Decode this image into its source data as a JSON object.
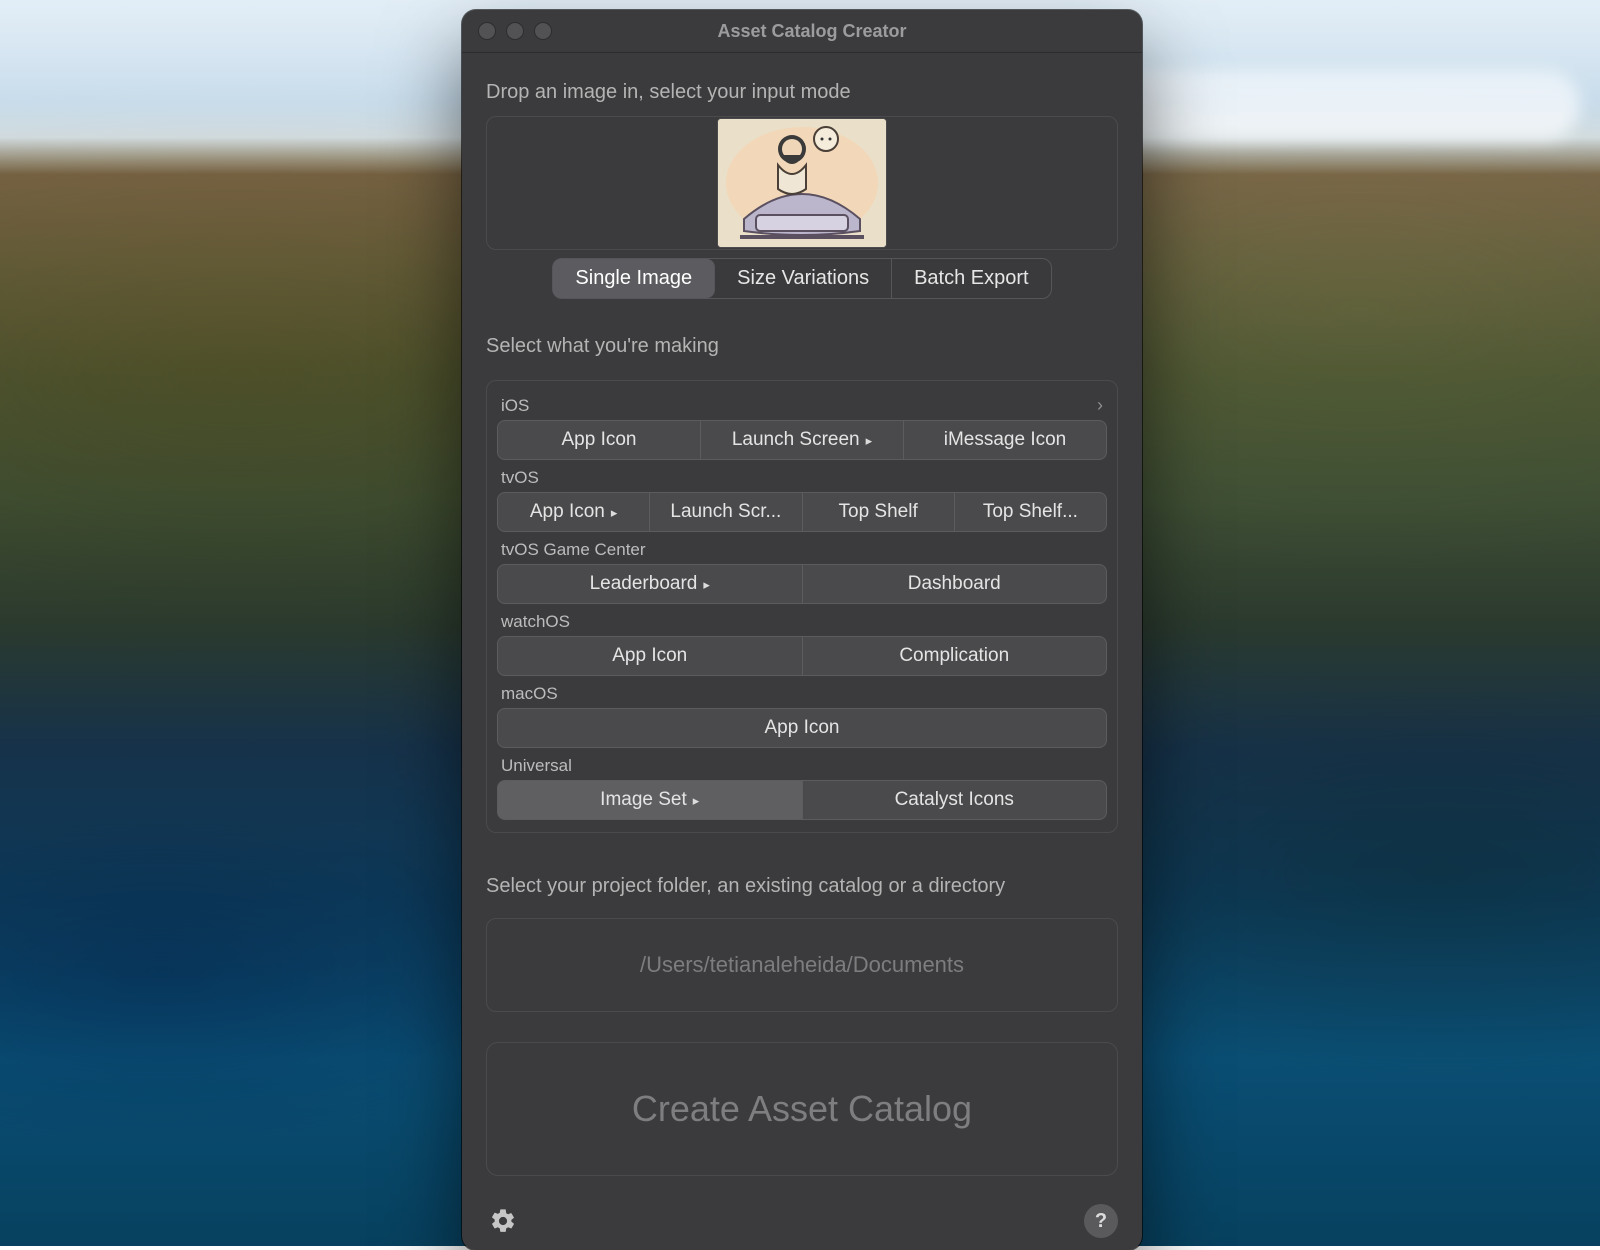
{
  "window": {
    "title": "Asset Catalog Creator"
  },
  "section_labels": {
    "drop": "Drop an image in, select your input mode",
    "making": "Select what you're making",
    "output": "Select your project folder, an existing catalog or a directory"
  },
  "input_mode": {
    "options": [
      "Single Image",
      "Size Variations",
      "Batch Export"
    ],
    "selected_index": 0
  },
  "platforms": {
    "ios": {
      "header": "iOS",
      "has_chevron": true,
      "buttons": [
        "App Icon",
        "Launch Screen",
        "iMessage Icon"
      ],
      "has_submenu": [
        false,
        true,
        false
      ]
    },
    "tvos": {
      "header": "tvOS",
      "buttons": [
        "App Icon",
        "Launch Scr...",
        "Top Shelf",
        "Top Shelf..."
      ],
      "has_submenu": [
        true,
        false,
        false,
        false
      ]
    },
    "tvos_gc": {
      "header": "tvOS Game Center",
      "buttons": [
        "Leaderboard",
        "Dashboard"
      ],
      "has_submenu": [
        true,
        false
      ]
    },
    "watchos": {
      "header": "watchOS",
      "buttons": [
        "App Icon",
        "Complication"
      ]
    },
    "macos": {
      "header": "macOS",
      "buttons": [
        "App Icon"
      ]
    },
    "universal": {
      "header": "Universal",
      "buttons": [
        "Image Set",
        "Catalyst Icons"
      ],
      "has_submenu": [
        true,
        false
      ],
      "selected_index": 0
    }
  },
  "output": {
    "path": "/Users/tetianaleheida/Documents"
  },
  "actions": {
    "create_label": "Create Asset Catalog"
  },
  "footer": {
    "settings_icon": "gear-icon",
    "help_icon": "help-icon",
    "help_label": "?"
  }
}
